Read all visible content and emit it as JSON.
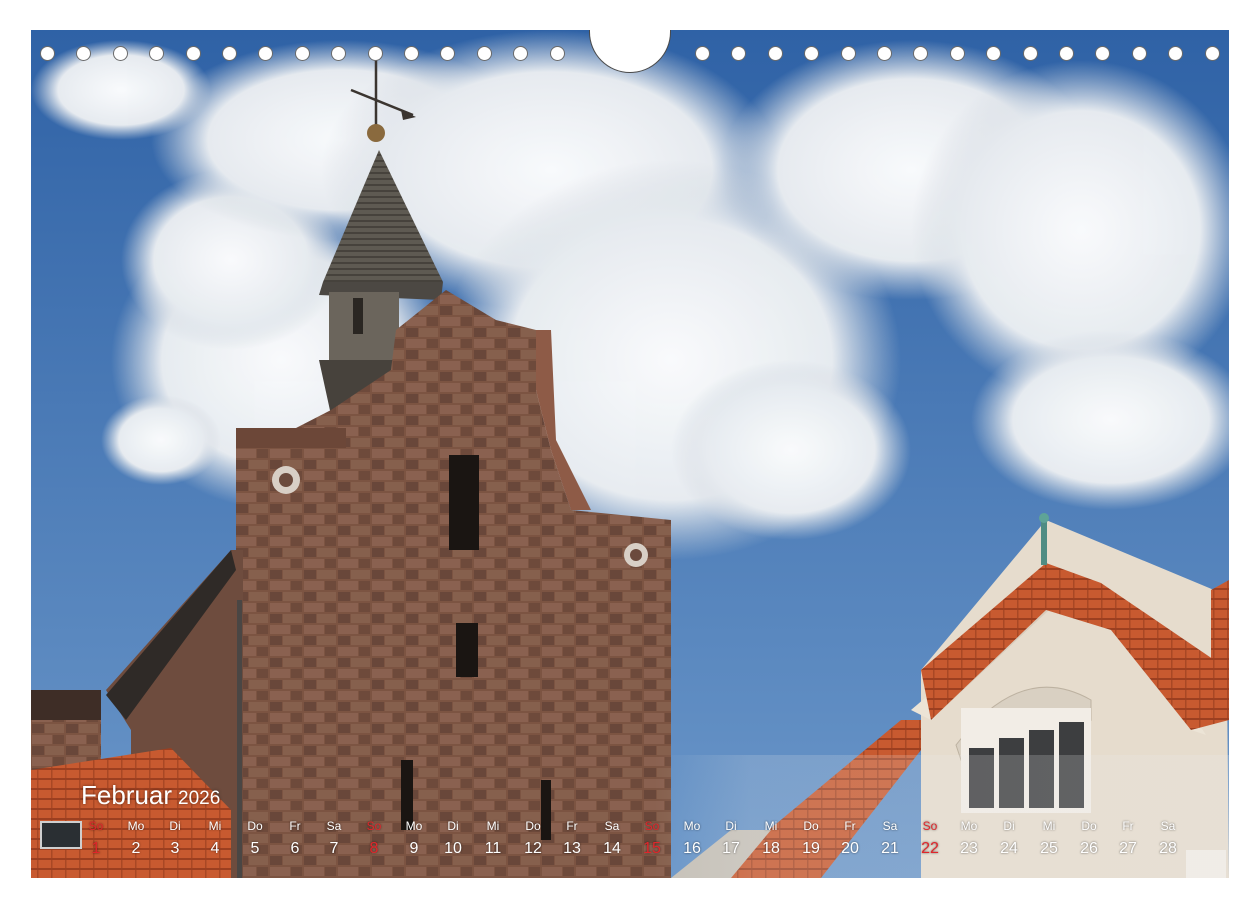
{
  "calendar": {
    "month": "Februar",
    "year": "2026",
    "weekdays": [
      "So",
      "Mo",
      "Di",
      "Mi",
      "Do",
      "Fr",
      "Sa",
      "So",
      "Mo",
      "Di",
      "Mi",
      "Do",
      "Fr",
      "Sa",
      "So",
      "Mo",
      "Di",
      "Mi",
      "Do",
      "Fr",
      "Sa",
      "So",
      "Mo",
      "Di",
      "Mi",
      "Do",
      "Fr",
      "Sa"
    ],
    "days": [
      "1",
      "2",
      "3",
      "4",
      "5",
      "6",
      "7",
      "8",
      "9",
      "10",
      "11",
      "12",
      "13",
      "14",
      "15",
      "16",
      "17",
      "18",
      "19",
      "20",
      "21",
      "22",
      "23",
      "24",
      "25",
      "26",
      "27",
      "28"
    ],
    "sunday_color": "#e0262b",
    "text_color": "#ffffff"
  },
  "photo": {
    "subject": "stone-tower-with-weathervane",
    "sky_color": "#3f74b3",
    "stone_color": "#7e5645",
    "roof_color": "#c8552e"
  }
}
